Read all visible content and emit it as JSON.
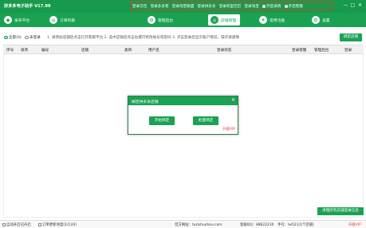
{
  "app": {
    "title": "拼多多电子助手 V17.99"
  },
  "top_menu": [
    {
      "label": "登录交包",
      "checkbox": false
    },
    {
      "label": "登录多多客",
      "checkbox": false
    },
    {
      "label": "登录淘宝联盟",
      "checkbox": false
    },
    {
      "label": "登录拼多多",
      "checkbox": false
    },
    {
      "label": "登录阿里巴巴",
      "checkbox": false
    },
    {
      "label": "登录淘宝",
      "checkbox": false
    },
    {
      "label": "开启采购",
      "checkbox": true
    },
    {
      "label": "开启客服",
      "checkbox": true
    }
  ],
  "window_controls": {
    "minimize": "—",
    "maximize": "□",
    "close": "✕"
  },
  "nav": [
    {
      "label": "发布平台",
      "icon": "publish-icon"
    },
    {
      "label": "订单列表",
      "icon": "order-list-icon"
    },
    {
      "label": "管理后台",
      "icon": "admin-icon"
    },
    {
      "label": "店铺管理",
      "icon": "store-icon",
      "active": true
    },
    {
      "label": "常用功能",
      "icon": "tools-icon"
    },
    {
      "label": "设置",
      "icon": "settings-icon"
    }
  ],
  "filter": {
    "all": "全部(0)",
    "unlogged": "未登录",
    "hint": "1. 请添加店铺后点击打开客服平台   2. 选中店铺后点击右键可修改账号或密码   3. 点击登录后显示账户情况，操作请谨慎",
    "bind_button": "绑定店铺"
  },
  "table": {
    "columns": [
      "序号",
      "排序",
      "编号",
      "店铺",
      "类目",
      "用户名",
      "登录状态",
      "登录客服",
      "管理后台",
      "登录"
    ]
  },
  "dialog": {
    "title": "绑定拼多多店铺",
    "close": "✕",
    "start_bind": "开始绑定",
    "batch_bind": "批量绑定",
    "upgrade": "升级VIP"
  },
  "clear_button": "清理所有店铺登录信息",
  "status": {
    "auto_open": "自动开启已开启",
    "order_refresh": "订单更新进度(1/1)(0)",
    "website": "官方网站：tuzishuohou.com",
    "service": "客服QQ：88622230",
    "cell": "手号：lw521(1个店铺)",
    "upgrade": "升级VIP"
  },
  "colors": {
    "brand_green": "#1aa253",
    "alert_red": "#e53935"
  }
}
